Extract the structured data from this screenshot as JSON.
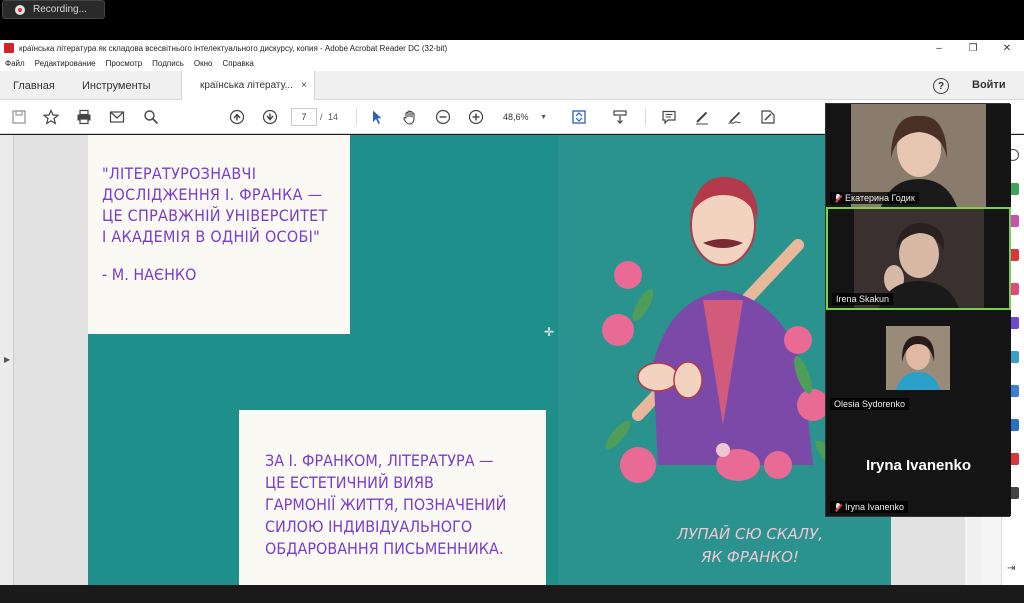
{
  "recording": {
    "label": "Recording..."
  },
  "window": {
    "title": "країнська література як складова всесвітнього інтелектуального дискурсу, копия - Adobe Acrobat Reader DC (32-bit)"
  },
  "menu": [
    "Файл",
    "Редактирование",
    "Просмотр",
    "Подпись",
    "Окно",
    "Справка"
  ],
  "tabs": {
    "home": "Главная",
    "tools": "Инструменты",
    "document": "країнська літерату...",
    "close": "×"
  },
  "header": {
    "help": "?",
    "login": "Войти"
  },
  "toolbar": {
    "page_current": "7",
    "page_sep": "/",
    "page_total": "14",
    "zoom": "48,6%"
  },
  "slide": {
    "quote": "\"ЛІТЕРАТУРОЗНАВЧІ\nДОСЛІДЖЕННЯ І. ФРАНКА —\nЦЕ СПРАВЖНІЙ УНІВЕРСИТЕТ\nІ АКАДЕМІЯ В ОДНІЙ ОСОБІ\"",
    "quote_author": "- М. НАЄНКО",
    "body": "ЗА І. ФРАНКОМ, ЛІТЕРАТУРА —\nЦЕ ЕСТЕТИЧНИЙ ВИЯВ\nГАРМОНІЇ ЖИТТЯ, ПОЗНАЧЕНИЙ\nСИЛОЮ ІНДИВІДУАЛЬНОГО\nОБДАРОВАННЯ ПИСЬМЕННИКА.",
    "slogan": "ЛУПАЙ СЮ СКАЛУ,\nЯК ФРАНКО!"
  },
  "participants": [
    {
      "name": "Екатерина Годик",
      "muted": true
    },
    {
      "name": "Irena Skakun",
      "muted": false,
      "active": true
    },
    {
      "name": "Olesia Sydorenko",
      "muted": false
    },
    {
      "name": "Iryna Ivanenko",
      "muted": true,
      "display_name": "Iryna Ivanenko"
    }
  ],
  "colors": {
    "slide_bg": "#1e8f8a",
    "text_purple": "#7a3ec9",
    "active_speaker": "#7bd04a"
  }
}
